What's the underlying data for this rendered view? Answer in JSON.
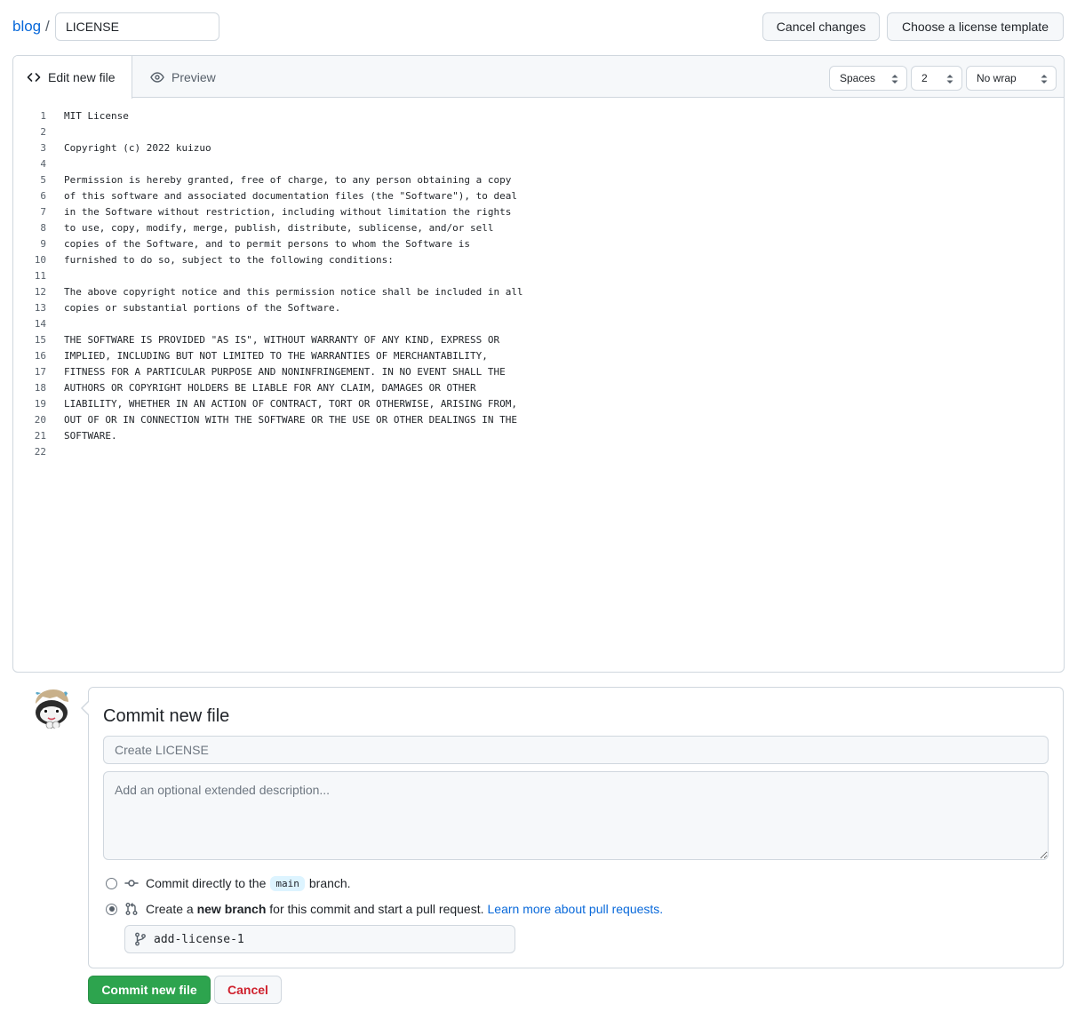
{
  "breadcrumb": {
    "repo": "blog",
    "separator": "/",
    "filename": "LICENSE"
  },
  "toolbar": {
    "cancel_changes": "Cancel changes",
    "choose_template": "Choose a license template"
  },
  "editor": {
    "tabs": {
      "edit": "Edit new file",
      "preview": "Preview"
    },
    "indent_mode": "Spaces",
    "indent_size": "2",
    "wrap_mode": "No wrap",
    "lines": [
      "MIT License",
      "",
      "Copyright (c) 2022 kuizuo",
      "",
      "Permission is hereby granted, free of charge, to any person obtaining a copy",
      "of this software and associated documentation files (the \"Software\"), to deal",
      "in the Software without restriction, including without limitation the rights",
      "to use, copy, modify, merge, publish, distribute, sublicense, and/or sell",
      "copies of the Software, and to permit persons to whom the Software is",
      "furnished to do so, subject to the following conditions:",
      "",
      "The above copyright notice and this permission notice shall be included in all",
      "copies or substantial portions of the Software.",
      "",
      "THE SOFTWARE IS PROVIDED \"AS IS\", WITHOUT WARRANTY OF ANY KIND, EXPRESS OR",
      "IMPLIED, INCLUDING BUT NOT LIMITED TO THE WARRANTIES OF MERCHANTABILITY,",
      "FITNESS FOR A PARTICULAR PURPOSE AND NONINFRINGEMENT. IN NO EVENT SHALL THE",
      "AUTHORS OR COPYRIGHT HOLDERS BE LIABLE FOR ANY CLAIM, DAMAGES OR OTHER",
      "LIABILITY, WHETHER IN AN ACTION OF CONTRACT, TORT OR OTHERWISE, ARISING FROM,",
      "OUT OF OR IN CONNECTION WITH THE SOFTWARE OR THE USE OR OTHER DEALINGS IN THE",
      "SOFTWARE.",
      ""
    ]
  },
  "commit": {
    "title": "Commit new file",
    "summary_placeholder": "Create LICENSE",
    "description_placeholder": "Add an optional extended description...",
    "direct": {
      "before": "Commit directly to the",
      "branch": "main",
      "after": "branch."
    },
    "new_branch": {
      "before": "Create a",
      "bold": "new branch",
      "after": "for this commit and start a pull request.",
      "link": "Learn more about pull requests."
    },
    "selected_option": "new_branch",
    "branch_name": "add-license-1",
    "submit_label": "Commit new file",
    "cancel_label": "Cancel"
  },
  "colors": {
    "primary": "#2da44e",
    "link": "#0969da",
    "danger": "#cf222e",
    "border": "#d0d7de"
  },
  "icons": {
    "edit_tab": "code-icon",
    "preview_tab": "eye-icon",
    "direct_option": "git-commit-icon",
    "branch_option": "git-pull-request-icon",
    "branch_field": "git-branch-icon"
  }
}
